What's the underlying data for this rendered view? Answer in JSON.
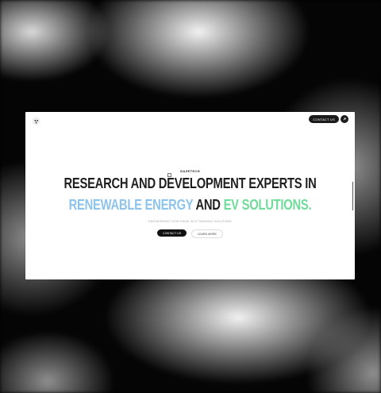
{
  "header": {
    "contact_label": "CONTACT US",
    "arrow_icon": "arrow-up-right-icon",
    "logo_icon": "dots-logo-icon"
  },
  "hero": {
    "brand": "GAZETECH",
    "headline_line1": "RESEARCH AND DEVELOPMENT EXPERTS IN",
    "headline_part_blue": "RENEWABLE ENERGY",
    "headline_part_dark": "AND",
    "headline_part_green": "EV SOLUTIONS.",
    "tagline": "ENGINEERING YOUR IDEAS INTO TANGIBLE SOLUTIONS",
    "primary_cta": "CONTACT US",
    "secondary_cta": "LEARN MORE"
  },
  "colors": {
    "accent_blue": "#8ec4ec",
    "accent_green": "#6fdc9a",
    "dark": "#1b1b1b"
  }
}
